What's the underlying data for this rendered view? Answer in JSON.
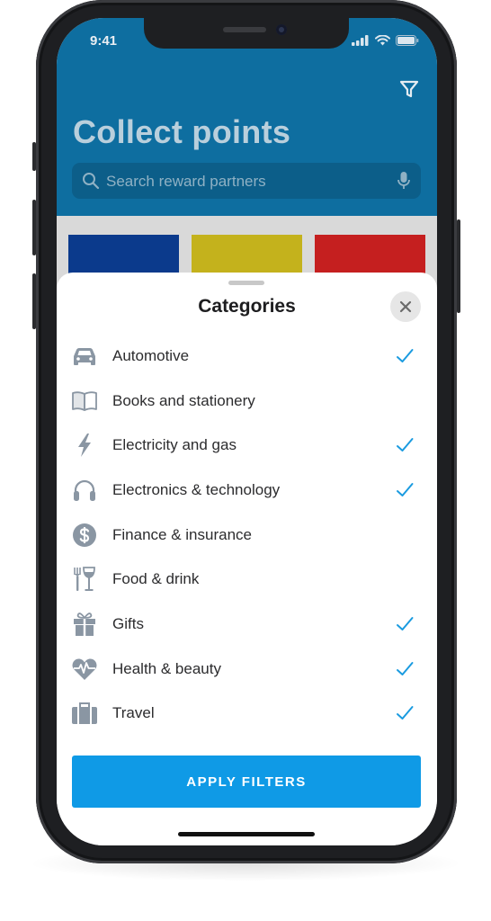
{
  "status_bar": {
    "time": "9:41"
  },
  "header": {
    "title": "Collect points",
    "search_placeholder": "Search reward partners"
  },
  "partner_tiles": [
    {
      "color": "#0b3a8c"
    },
    {
      "color": "#c4b21c"
    },
    {
      "color": "#c51f1f"
    }
  ],
  "sheet": {
    "title": "Categories",
    "categories": [
      {
        "label": "Automotive",
        "icon": "car-icon",
        "checked": true
      },
      {
        "label": "Books and stationery",
        "icon": "book-icon",
        "checked": false
      },
      {
        "label": "Electricity and gas",
        "icon": "lightning-icon",
        "checked": true
      },
      {
        "label": "Electronics & technology",
        "icon": "headphones-icon",
        "checked": true
      },
      {
        "label": "Finance & insurance",
        "icon": "dollar-icon",
        "checked": false
      },
      {
        "label": "Food & drink",
        "icon": "fork-glass-icon",
        "checked": false
      },
      {
        "label": "Gifts",
        "icon": "gift-icon",
        "checked": true
      },
      {
        "label": "Health & beauty",
        "icon": "heart-pulse-icon",
        "checked": true
      },
      {
        "label": "Travel",
        "icon": "suitcase-icon",
        "checked": true
      }
    ],
    "apply_label": "APPLY FILTERS"
  },
  "colors": {
    "accent": "#0f9ae6",
    "check": "#1a9be0",
    "icon_gray": "#8a96a3",
    "header_blue": "#0e6ea0"
  }
}
